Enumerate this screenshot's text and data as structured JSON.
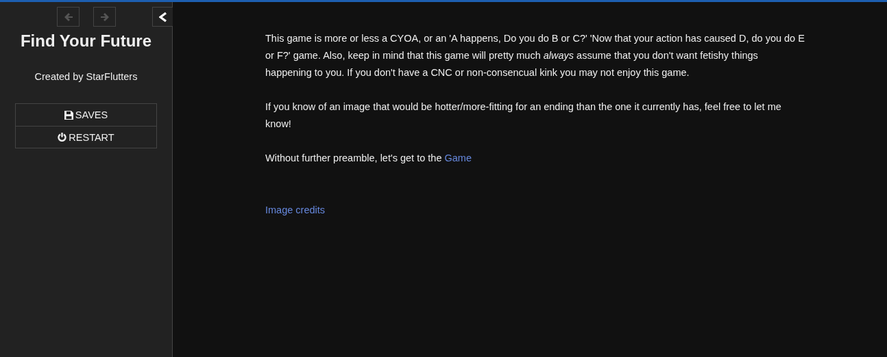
{
  "sidebar": {
    "history": [
      {
        "kind": "back",
        "disabled": true
      },
      {
        "kind": "forward",
        "disabled": true
      }
    ],
    "stowed": false,
    "title": "Find Your Future",
    "author": "Created by StarFlutters",
    "menu": [
      {
        "kind": "saves",
        "label": "SAVES"
      },
      {
        "kind": "restart",
        "label": "RESTART"
      }
    ]
  },
  "passage": {
    "paragraphs": [
      {
        "text": "This game is more or less a CYOA, or an 'A happens, Do you do B or C?' 'Now that your action has caused D, do you do E or F?' game. Also, keep in mind that this game will pretty much *always* assume that you don't want fetishy things happening to you. If you don't have a CNC or non-consencual kink you may not enjoy this game."
      },
      {
        "text": "If you know of an image that would be hotter/more-fitting for an ending than the one it currently has, feel free to let me know!"
      },
      {
        "text": "Without further preamble, let's get to the ",
        "link": "Game"
      }
    ],
    "credits_link": "Image credits"
  }
}
